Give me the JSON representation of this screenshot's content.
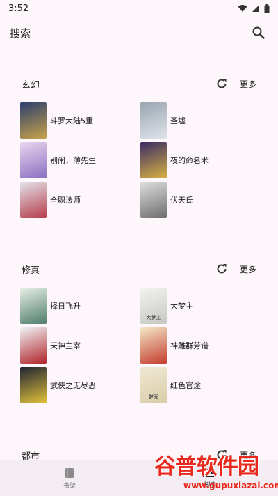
{
  "status": {
    "time": "3:52"
  },
  "search": {
    "label": "搜索",
    "icon": "search-icon"
  },
  "sections": [
    {
      "title": "玄幻",
      "more": "更多",
      "books": [
        {
          "title": "斗罗大陆5重",
          "cover_colors": [
            "#2b3f6e",
            "#c9a24a"
          ],
          "cover_text": ""
        },
        {
          "title": "圣墟",
          "cover_colors": [
            "#9aa4b0",
            "#dfe4ea"
          ],
          "cover_text": ""
        },
        {
          "title": "别闹，薄先生",
          "cover_colors": [
            "#e9d6ef",
            "#8a6fc0"
          ],
          "cover_text": ""
        },
        {
          "title": "夜的命名术",
          "cover_colors": [
            "#3b2b66",
            "#d8b241"
          ],
          "cover_text": ""
        },
        {
          "title": "全职法师",
          "cover_colors": [
            "#e4e2ea",
            "#b53c4a"
          ],
          "cover_text": ""
        },
        {
          "title": "伏天氏",
          "cover_colors": [
            "#dedede",
            "#6d6d6d"
          ],
          "cover_text": ""
        }
      ]
    },
    {
      "title": "修真",
      "more": "更多",
      "books": [
        {
          "title": "择日飞升",
          "cover_colors": [
            "#e9efe7",
            "#4e7d6a"
          ],
          "cover_text": ""
        },
        {
          "title": "大梦主",
          "cover_colors": [
            "#f2f2f0",
            "#c7c7c2"
          ],
          "cover_text": "大梦主"
        },
        {
          "title": "天神主宰",
          "cover_colors": [
            "#f0f2f4",
            "#b0242a"
          ],
          "cover_text": ""
        },
        {
          "title": "神雕群芳谱",
          "cover_colors": [
            "#f3e6c6",
            "#c33d2d"
          ],
          "cover_text": ""
        },
        {
          "title": "武侠之无尽恶",
          "cover_colors": [
            "#1e2433",
            "#e3c23a"
          ],
          "cover_text": ""
        },
        {
          "title": "红色官途",
          "cover_colors": [
            "#efe8d2",
            "#d9cda8"
          ],
          "cover_text": "梦元"
        }
      ]
    },
    {
      "title": "都市",
      "more": "更多",
      "books": []
    }
  ],
  "nav": [
    {
      "label": "书架",
      "icon": "bookshelf-icon",
      "active": false
    },
    {
      "label": "书城",
      "icon": "store-list-icon",
      "active": true
    }
  ],
  "watermark": {
    "main": "谷普软件园",
    "url": "www.gupuxlazal.com"
  }
}
